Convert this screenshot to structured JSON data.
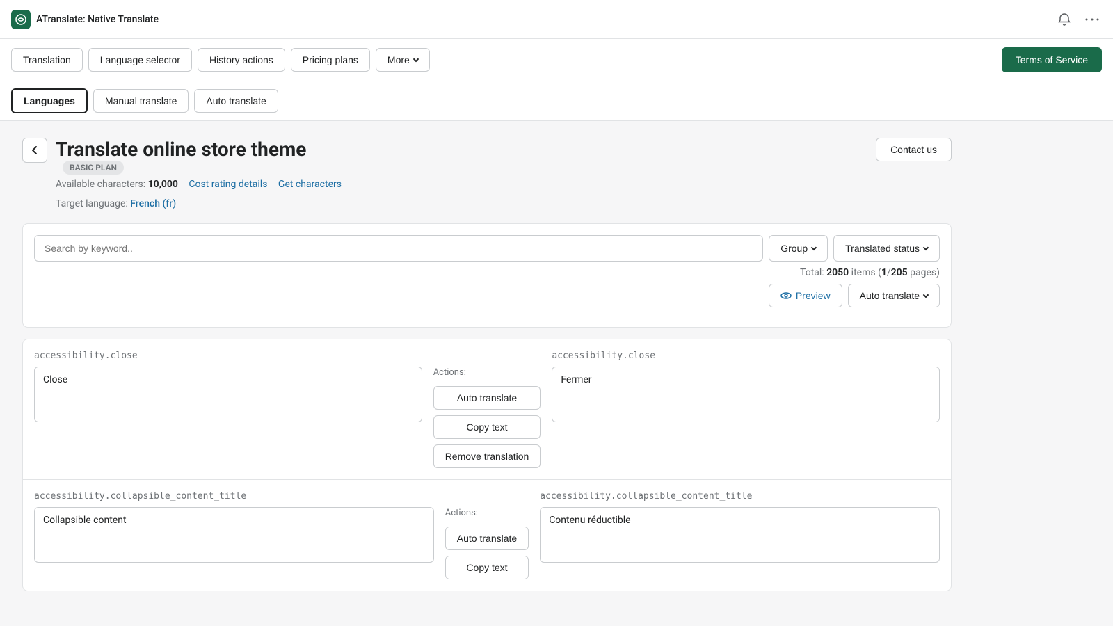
{
  "app": {
    "logo_text": "ATranslate: Native Translate",
    "logo_initials": "A"
  },
  "top_bar": {
    "notification_icon": "bell",
    "menu_icon": "more"
  },
  "nav": {
    "items": [
      {
        "id": "translation",
        "label": "Translation",
        "active": false
      },
      {
        "id": "language-selector",
        "label": "Language selector",
        "active": false
      },
      {
        "id": "history-actions",
        "label": "History actions",
        "active": false
      },
      {
        "id": "pricing-plans",
        "label": "Pricing plans",
        "active": false
      },
      {
        "id": "more",
        "label": "More",
        "active": false,
        "has_dropdown": true
      }
    ],
    "cta_label": "Terms of Service"
  },
  "sub_nav": {
    "items": [
      {
        "id": "languages",
        "label": "Languages",
        "active": true
      },
      {
        "id": "manual-translate",
        "label": "Manual translate",
        "active": false
      },
      {
        "id": "auto-translate",
        "label": "Auto translate",
        "active": false
      }
    ]
  },
  "page": {
    "title": "Translate online store theme",
    "plan_badge": "BASIC PLAN",
    "available_chars_label": "Available characters:",
    "available_chars_value": "10,000",
    "cost_rating_link": "Cost rating details",
    "get_characters_link": "Get characters",
    "target_language_label": "Target language:",
    "target_language_value": "French (fr)",
    "contact_us_label": "Contact us"
  },
  "search": {
    "placeholder": "Search by keyword..",
    "group_label": "Group",
    "translated_status_label": "Translated status"
  },
  "pagination": {
    "total_label": "Total:",
    "total_count": "2050",
    "items_label": "items",
    "page_current": "1",
    "page_total": "205",
    "pages_label": "pages"
  },
  "actions_row": {
    "preview_label": "Preview",
    "auto_translate_label": "Auto translate"
  },
  "translation_items": [
    {
      "source_key": "accessibility.close",
      "source_text": "Close",
      "target_key": "accessibility.close",
      "target_text": "Fermer",
      "actions_label": "Actions:",
      "buttons": [
        "Auto translate",
        "Copy text",
        "Remove translation"
      ]
    },
    {
      "source_key": "accessibility.collapsible_content_title",
      "source_text": "Collapsible content",
      "target_key": "accessibility.collapsible_content_title",
      "target_text": "Contenu réductible",
      "actions_label": "Actions:",
      "buttons": [
        "Auto translate",
        "Copy text"
      ]
    }
  ]
}
